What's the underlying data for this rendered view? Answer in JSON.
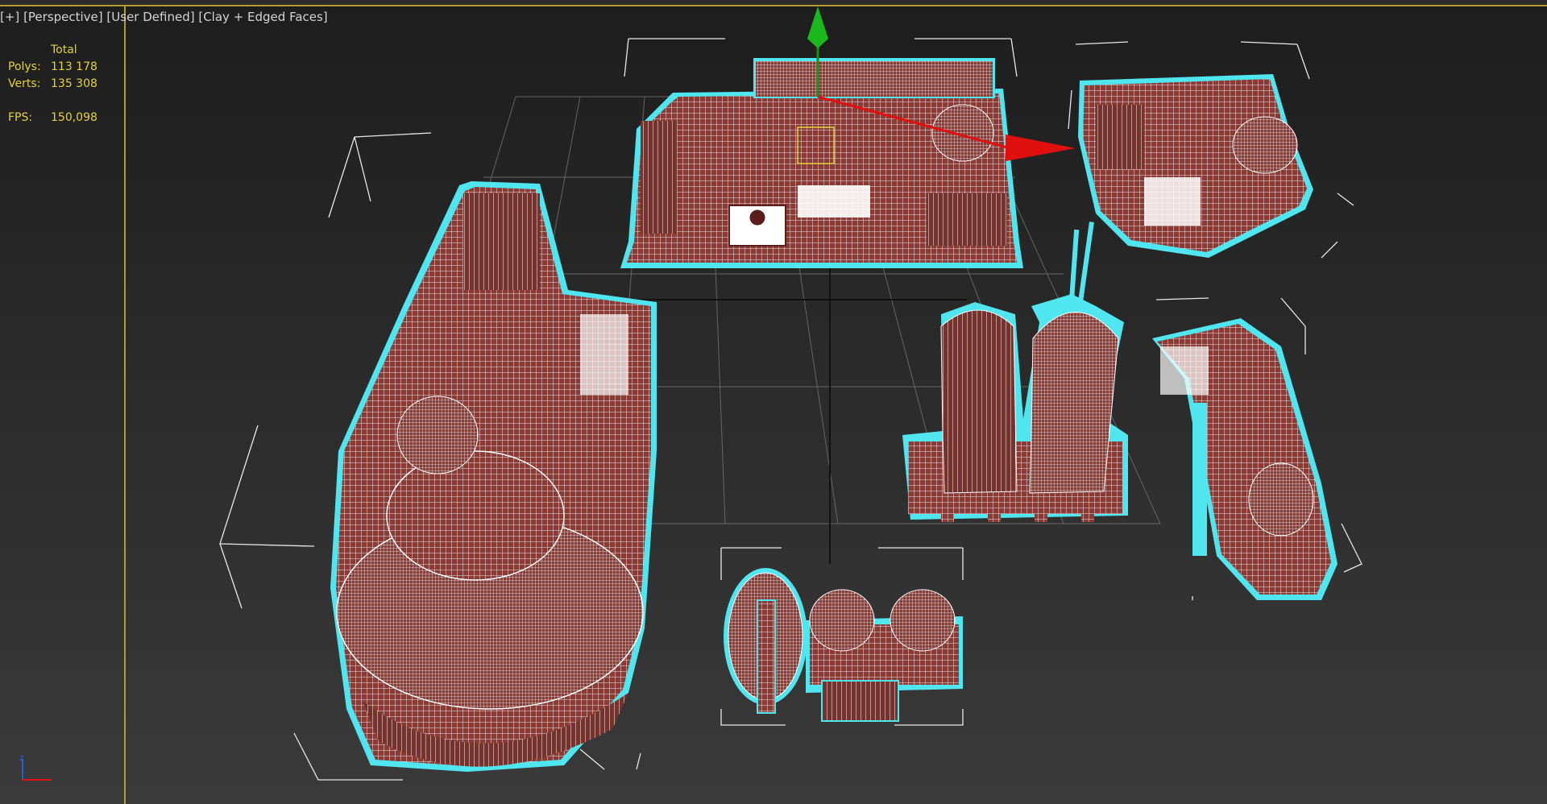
{
  "viewport": {
    "label_plus": "[+]",
    "label_view": "[Perspective]",
    "label_user": "[User Defined]",
    "label_shading": "[Clay + Edged Faces]"
  },
  "stats": {
    "header": "Total",
    "polys_label": "Polys:",
    "polys_value": "113 178",
    "verts_label": "Verts:",
    "verts_value": "135 308",
    "fps_label": "FPS:",
    "fps_value": "150,098"
  },
  "gizmo": {
    "axis_z": "z"
  },
  "colors": {
    "model_fill": "#8a3b35",
    "model_dark": "#5a1f1c",
    "selection_outline": "#4fe6f0",
    "grid": "#777777",
    "stats_text": "#e5d23a",
    "axis_x": "#e01010",
    "axis_y": "#10a010"
  }
}
